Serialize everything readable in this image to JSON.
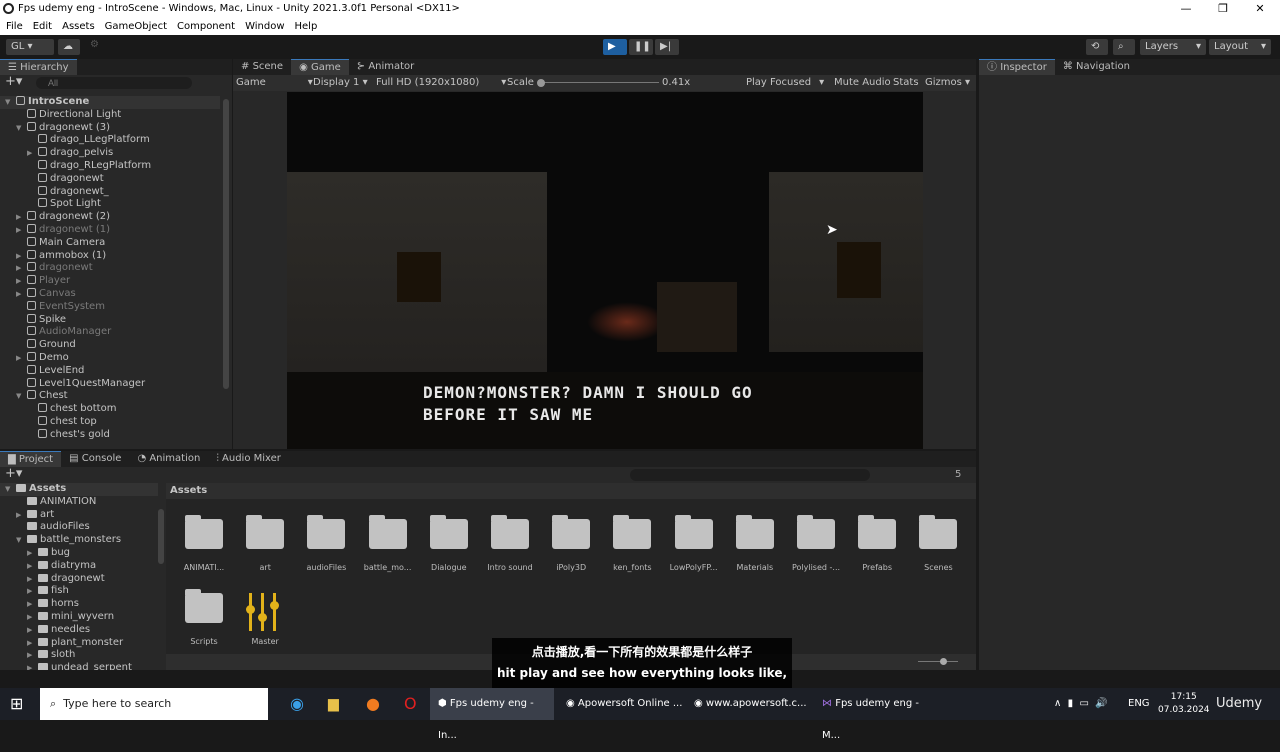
{
  "window": {
    "title": "Fps udemy eng - IntroScene - Windows, Mac, Linux - Unity 2021.3.0f1 Personal <DX11>",
    "menu": [
      "File",
      "Edit",
      "Assets",
      "GameObject",
      "Component",
      "Window",
      "Help"
    ]
  },
  "toolbar": {
    "account": "GL ▾",
    "layers": "Layers",
    "layout": "Layout"
  },
  "hierarchy": {
    "tab": "Hierarchy",
    "search_placeholder": "All",
    "items": [
      {
        "label": "IntroScene",
        "level": 0,
        "arrow": "open",
        "bold": true
      },
      {
        "label": "Directional Light",
        "level": 1
      },
      {
        "label": "dragonewt (3)",
        "level": 1,
        "arrow": "open"
      },
      {
        "label": "drago_LLegPlatform",
        "level": 2
      },
      {
        "label": "drago_pelvis",
        "level": 2,
        "arrow": "closed"
      },
      {
        "label": "drago_RLegPlatform",
        "level": 2
      },
      {
        "label": "dragonewt",
        "level": 2
      },
      {
        "label": "dragonewt_",
        "level": 2
      },
      {
        "label": "Spot Light",
        "level": 2
      },
      {
        "label": "dragonewt (2)",
        "level": 1,
        "arrow": "closed"
      },
      {
        "label": "dragonewt (1)",
        "level": 1,
        "arrow": "closed",
        "dim": true
      },
      {
        "label": "Main Camera",
        "level": 1
      },
      {
        "label": "ammobox (1)",
        "level": 1,
        "arrow": "closed"
      },
      {
        "label": "dragonewt",
        "level": 1,
        "arrow": "closed",
        "dim": true
      },
      {
        "label": "Player",
        "level": 1,
        "arrow": "closed",
        "dim": true
      },
      {
        "label": "Canvas",
        "level": 1,
        "arrow": "closed",
        "dim": true
      },
      {
        "label": "EventSystem",
        "level": 1,
        "dim": true
      },
      {
        "label": "Spike",
        "level": 1
      },
      {
        "label": "AudioManager",
        "level": 1,
        "dim": true
      },
      {
        "label": "Ground",
        "level": 1
      },
      {
        "label": "Demo",
        "level": 1,
        "arrow": "closed"
      },
      {
        "label": "LevelEnd",
        "level": 1
      },
      {
        "label": "Level1QuestManager",
        "level": 1
      },
      {
        "label": "Chest",
        "level": 1,
        "arrow": "open"
      },
      {
        "label": "chest bottom",
        "level": 2
      },
      {
        "label": "chest top",
        "level": 2
      },
      {
        "label": "chest's gold",
        "level": 2
      }
    ]
  },
  "center_tabs": [
    "Scene",
    "Game",
    "Animator"
  ],
  "game_toolbar": {
    "mode": "Game",
    "display": "Display 1",
    "resolution": "Full HD (1920x1080)",
    "scale_label": "Scale",
    "scale_value": "0.41x",
    "play_focused": "Play Focused",
    "mute": "Mute Audio",
    "stats": "Stats",
    "gizmos": "Gizmos"
  },
  "game_view": {
    "dialogue_line1": "DEMON?MONSTER? DAMN I SHOULD GO",
    "dialogue_line2": "BEFORE IT SAW ME"
  },
  "inspector_tabs": [
    "Inspector",
    "Navigation"
  ],
  "bottom_tabs": [
    "Project",
    "Console",
    "Animation",
    "Audio Mixer"
  ],
  "project": {
    "hidden_count": "5",
    "tree": [
      {
        "label": "Assets",
        "level": 0,
        "arrow": "open",
        "bold": true
      },
      {
        "label": "ANIMATION",
        "level": 1
      },
      {
        "label": "art",
        "level": 1,
        "arrow": "closed"
      },
      {
        "label": "audioFiles",
        "level": 1
      },
      {
        "label": "battle_monsters",
        "level": 1,
        "arrow": "open"
      },
      {
        "label": "bug",
        "level": 2,
        "arrow": "closed"
      },
      {
        "label": "diatryma",
        "level": 2,
        "arrow": "closed"
      },
      {
        "label": "dragonewt",
        "level": 2,
        "arrow": "closed"
      },
      {
        "label": "fish",
        "level": 2,
        "arrow": "closed"
      },
      {
        "label": "horns",
        "level": 2,
        "arrow": "closed"
      },
      {
        "label": "mini_wyvern",
        "level": 2,
        "arrow": "closed"
      },
      {
        "label": "needles",
        "level": 2,
        "arrow": "closed"
      },
      {
        "label": "plant_monster",
        "level": 2,
        "arrow": "closed"
      },
      {
        "label": "sloth",
        "level": 2,
        "arrow": "closed"
      },
      {
        "label": "undead_serpent",
        "level": 2,
        "arrow": "closed"
      }
    ],
    "breadcrumb": "Assets",
    "assets": [
      "ANIMATI...",
      "art",
      "audioFiles",
      "battle_mo...",
      "Dialogue",
      "Intro sound",
      "iPoly3D",
      "ken_fonts",
      "LowPolyFP...",
      "Materials",
      "Polylised -...",
      "Prefabs",
      "Scenes",
      "Scripts",
      "Master"
    ]
  },
  "subtitle": {
    "zh": "点击播放,看一下所有的效果都是什么样子",
    "en": "hit play and see how everything looks like,"
  },
  "taskbar": {
    "search_placeholder": "Type here to search",
    "tasks": [
      "Fps udemy eng - In...",
      "Apowersoft Online ...",
      "www.apowersoft.c...",
      "Fps udemy eng - M..."
    ],
    "lang": "ENG",
    "time": "17:15",
    "date": "07.03.2024",
    "watermark": "Udemy"
  },
  "colors": {
    "accent": "#3a79bb",
    "play_button": "#1e5fa0",
    "mixer": "#e2b21a"
  }
}
